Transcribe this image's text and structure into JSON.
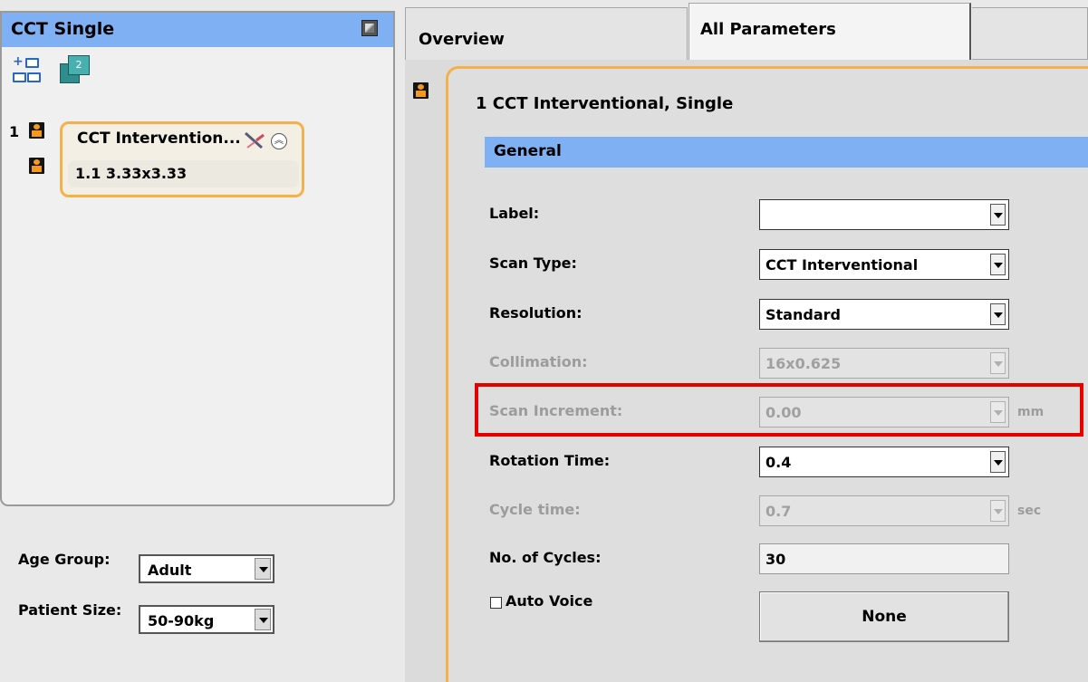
{
  "protocol_panel": {
    "title": "CCT Single",
    "row_number": "1",
    "node_title": "CCT Intervention...",
    "sub_item_label": "1.1 3.33x3.33",
    "series_badge": "2"
  },
  "patient_settings": {
    "age_group_label": "Age Group:",
    "age_group_value": "Adult",
    "patient_size_label": "Patient Size:",
    "patient_size_value": "50-90kg"
  },
  "tabs": [
    {
      "label": "Overview",
      "active": false
    },
    {
      "label": "All Parameters",
      "active": true
    }
  ],
  "parameters": {
    "title": "1  CCT Interventional, Single",
    "section": "General",
    "fields": [
      {
        "label": "Label:",
        "value": "",
        "enabled": true,
        "unit": ""
      },
      {
        "label": "Scan Type:",
        "value": "CCT Interventional",
        "enabled": true,
        "unit": ""
      },
      {
        "label": "Resolution:",
        "value": "Standard",
        "enabled": true,
        "unit": ""
      },
      {
        "label": "Collimation:",
        "value": "16x0.625",
        "enabled": false,
        "unit": ""
      },
      {
        "label": "Scan Increment:",
        "value": "0.00",
        "enabled": false,
        "unit": "mm"
      },
      {
        "label": "Rotation Time:",
        "value": "0.4",
        "enabled": true,
        "unit": ""
      },
      {
        "label": "Cycle time:",
        "value": "0.7",
        "enabled": false,
        "unit": "sec"
      }
    ],
    "cycles_label": "No. of Cycles:",
    "cycles_value": "30",
    "auto_voice_label": "Auto Voice",
    "auto_voice_checked": false,
    "voice_button_label": "None"
  },
  "colors": {
    "header_blue": "#7fb0f4",
    "selection_orange": "#f5b04a",
    "highlight_red": "#e60000",
    "disabled_text": "#9c9c9c"
  }
}
